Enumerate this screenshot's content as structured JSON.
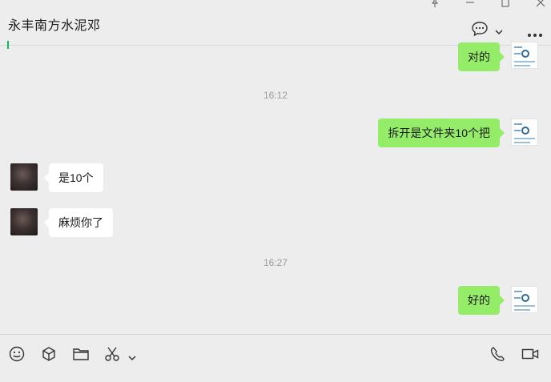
{
  "chat": {
    "title": "永丰南方水泥邓"
  },
  "messages": [
    {
      "type": "bubble",
      "side": "me",
      "text": "对的"
    },
    {
      "type": "time",
      "text": "16:12"
    },
    {
      "type": "bubble",
      "side": "me",
      "text": "拆开是文件夹10个把"
    },
    {
      "type": "bubble",
      "side": "other",
      "text": "是10个"
    },
    {
      "type": "bubble",
      "side": "other",
      "text": "麻烦你了"
    },
    {
      "type": "time",
      "text": "16:27"
    },
    {
      "type": "bubble",
      "side": "me",
      "text": "好的"
    }
  ],
  "colors": {
    "self_bubble": "#95ec69",
    "other_bubble": "#ffffff",
    "background": "#ededed",
    "cursor": "#07c160"
  },
  "icons": {
    "window": [
      "pin-icon",
      "minimize-icon",
      "maximize-icon",
      "close-icon"
    ],
    "header": [
      "chat-bubble-icon",
      "chevron-down-icon",
      "more-icon"
    ],
    "toolbar": [
      "emoji-icon",
      "cube-icon",
      "folder-icon",
      "scissors-icon",
      "chevron-down-icon",
      "phone-icon",
      "video-icon"
    ]
  }
}
